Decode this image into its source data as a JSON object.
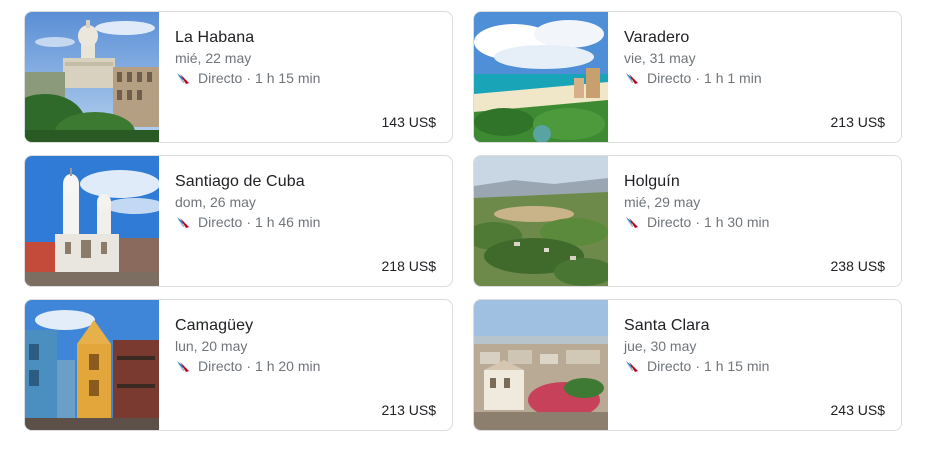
{
  "destinations": [
    {
      "city": "La Habana",
      "date": "mié, 22 may",
      "stops": "Directo",
      "separator": "·",
      "duration": "1 h 15 min",
      "price": "143 US$",
      "image": "capitolio-photo"
    },
    {
      "city": "Varadero",
      "date": "vie, 31 may",
      "stops": "Directo",
      "separator": "·",
      "duration": "1 h 1 min",
      "price": "213 US$",
      "image": "beach-photo"
    },
    {
      "city": "Santiago de Cuba",
      "date": "dom, 26 may",
      "stops": "Directo",
      "separator": "·",
      "duration": "1 h 46 min",
      "price": "218 US$",
      "image": "cathedral-photo"
    },
    {
      "city": "Holguín",
      "date": "mié, 29 may",
      "stops": "Directo",
      "separator": "·",
      "duration": "1 h 30 min",
      "price": "238 US$",
      "image": "aerial-town-photo"
    },
    {
      "city": "Camagüey",
      "date": "lun, 20 may",
      "stops": "Directo",
      "separator": "·",
      "duration": "1 h 20 min",
      "price": "213 US$",
      "image": "colonial-street-photo"
    },
    {
      "city": "Santa Clara",
      "date": "jue, 30 may",
      "stops": "Directo",
      "separator": "·",
      "duration": "1 h 15 min",
      "price": "243 US$",
      "image": "city-rooftops-photo"
    }
  ],
  "airline_icon": "american-airlines-icon",
  "colors": {
    "border": "#dadce0",
    "title": "#202124",
    "secondary": "#70757a",
    "airline_red": "#c30019",
    "airline_blue": "#0078d2"
  }
}
